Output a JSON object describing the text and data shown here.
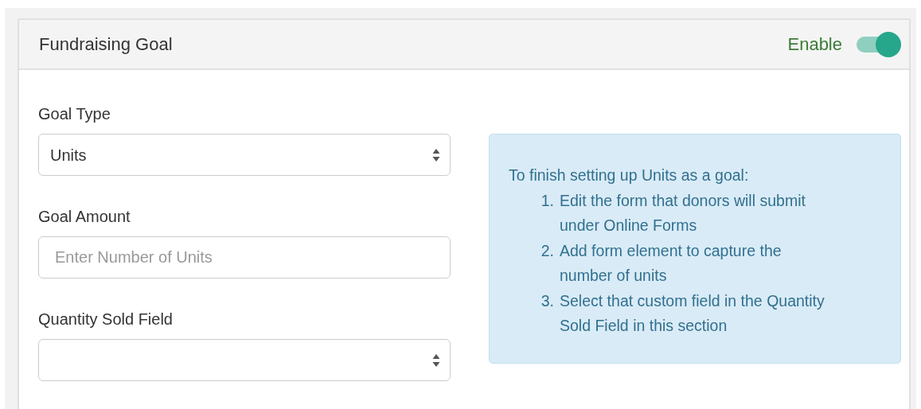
{
  "panel": {
    "title": "Fundraising Goal",
    "toggle": {
      "label": "Enable",
      "on": true
    }
  },
  "fields": [
    {
      "kind": "select",
      "label": "Goal Type",
      "value": "Units"
    },
    {
      "kind": "input",
      "label": "Goal Amount",
      "placeholder": "Enter Number of Units"
    },
    {
      "kind": "select",
      "label": "Quantity Sold Field"
    }
  ],
  "info": {
    "intro": "To finish setting up Units as a goal:",
    "steps": [
      {
        "number": "1.",
        "text": "Edit the form that donors will submit under Online Forms"
      },
      {
        "number": "2.",
        "text": "Add form element to capture the number of units"
      },
      {
        "number": "3.",
        "text": "Select that custom field in the Quantity Sold Field in this section"
      }
    ]
  }
}
